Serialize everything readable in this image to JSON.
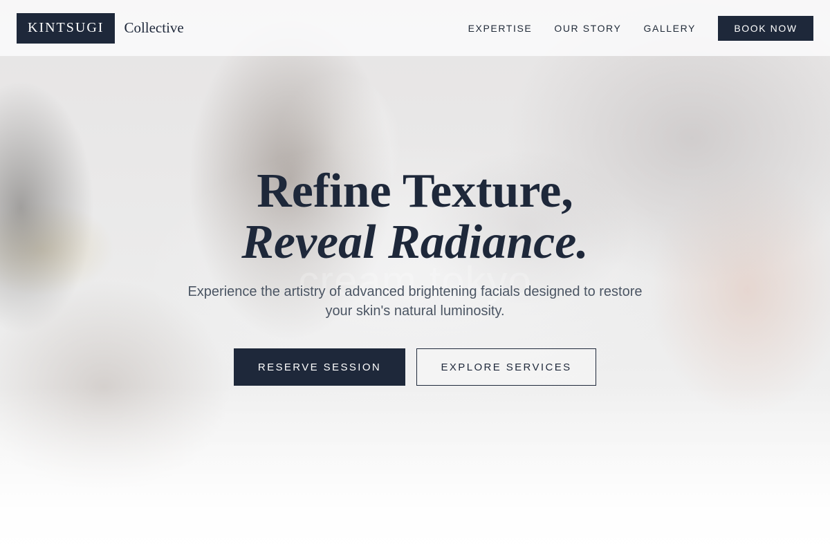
{
  "header": {
    "brand_name": "KINTSUGI",
    "brand_sub": "Collective",
    "nav": [
      {
        "label": "EXPERTISE"
      },
      {
        "label": "OUR STORY"
      },
      {
        "label": "GALLERY"
      }
    ],
    "book_label": "BOOK NOW"
  },
  "hero": {
    "headline_line1": "Refine Texture,",
    "headline_line2": "Reveal Radiance.",
    "watermark": "cream tokyo",
    "subtext": "Experience the artistry of advanced brightening facials designed to restore your skin's natural luminosity.",
    "primary_cta": "RESERVE SESSION",
    "secondary_cta": "EXPLORE SERVICES"
  },
  "colors": {
    "navy": "#1e283a",
    "body_text": "#4b5563",
    "white": "#ffffff"
  }
}
